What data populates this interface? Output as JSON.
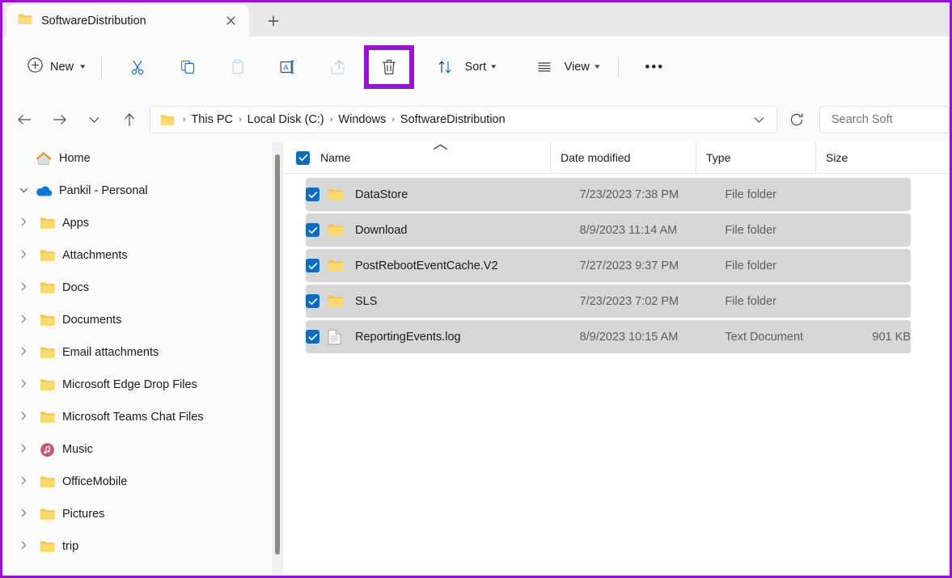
{
  "window": {
    "tab_title": "SoftwareDistribution",
    "tab_close_icon": "close-icon",
    "new_tab_icon": "plus-icon"
  },
  "toolbar": {
    "new_label": "New",
    "sort_label": "Sort",
    "view_label": "View",
    "overflow_label": "•••",
    "items": [
      {
        "name": "new-button",
        "icon": "plus-circle-icon",
        "enabled": true
      },
      {
        "name": "cut-button",
        "icon": "scissors-icon",
        "enabled": true
      },
      {
        "name": "copy-button",
        "icon": "copy-icon",
        "enabled": true
      },
      {
        "name": "paste-button",
        "icon": "clipboard-icon",
        "enabled": false
      },
      {
        "name": "rename-button",
        "icon": "rename-icon",
        "enabled": true
      },
      {
        "name": "share-button",
        "icon": "share-icon",
        "enabled": false
      },
      {
        "name": "delete-button",
        "icon": "trash-icon",
        "enabled": true,
        "highlighted": true
      },
      {
        "name": "sort-button",
        "icon": "sort-arrows-icon",
        "enabled": true
      },
      {
        "name": "view-button",
        "icon": "list-lines-icon",
        "enabled": true
      },
      {
        "name": "see-more-button",
        "icon": "ellipsis-icon",
        "enabled": true
      }
    ],
    "highlight_color": "#9614d0"
  },
  "address": {
    "back_icon": "arrow-left-icon",
    "forward_icon": "arrow-right-icon",
    "recent_icon": "chevron-down-icon",
    "up_icon": "arrow-up-icon",
    "folder_icon": "folder-icon",
    "breadcrumbs": [
      "This PC",
      "Local Disk (C:)",
      "Windows",
      "SoftwareDistribution"
    ],
    "separator": "›",
    "dropdown_icon": "chevron-down-icon",
    "refresh_icon": "refresh-icon",
    "search_value": "",
    "search_placeholder": "Search Soft"
  },
  "sidebar": {
    "items": [
      {
        "label": "Home",
        "icon": "home-icon",
        "expander": "",
        "indent": false
      },
      {
        "label": "Pankil - Personal",
        "icon": "onedrive-cloud-icon",
        "expander": "⌄",
        "indent": false,
        "expanded": true
      },
      {
        "label": "Apps",
        "icon": "folder-icon",
        "expander": "›",
        "indent": true
      },
      {
        "label": "Attachments",
        "icon": "folder-icon",
        "expander": "›",
        "indent": true
      },
      {
        "label": "Docs",
        "icon": "folder-icon",
        "expander": "›",
        "indent": true
      },
      {
        "label": "Documents",
        "icon": "folder-icon",
        "expander": "›",
        "indent": true
      },
      {
        "label": "Email attachments",
        "icon": "folder-icon",
        "expander": "›",
        "indent": true
      },
      {
        "label": "Microsoft Edge Drop Files",
        "icon": "folder-icon",
        "expander": "›",
        "indent": true
      },
      {
        "label": "Microsoft Teams Chat Files",
        "icon": "folder-icon",
        "expander": "›",
        "indent": true
      },
      {
        "label": "Music",
        "icon": "music-note-icon",
        "expander": "›",
        "indent": true
      },
      {
        "label": "OfficeMobile",
        "icon": "folder-icon",
        "expander": "›",
        "indent": true
      },
      {
        "label": "Pictures",
        "icon": "folder-icon",
        "expander": "›",
        "indent": true
      },
      {
        "label": "trip",
        "icon": "folder-icon",
        "expander": "›",
        "indent": true
      }
    ]
  },
  "file_list": {
    "select_all_checked": true,
    "sort_column": "Name",
    "sort_direction": "ascending",
    "columns": [
      {
        "label": "Name"
      },
      {
        "label": "Date modified"
      },
      {
        "label": "Type"
      },
      {
        "label": "Size"
      }
    ],
    "rows": [
      {
        "name": "DataStore",
        "date": "7/23/2023 7:38 PM",
        "type": "File folder",
        "size": "",
        "icon": "folder-icon",
        "selected": true,
        "checked": true
      },
      {
        "name": "Download",
        "date": "8/9/2023 11:14 AM",
        "type": "File folder",
        "size": "",
        "icon": "folder-icon",
        "selected": true,
        "checked": true
      },
      {
        "name": "PostRebootEventCache.V2",
        "date": "7/27/2023 9:37 PM",
        "type": "File folder",
        "size": "",
        "icon": "folder-icon",
        "selected": true,
        "checked": true
      },
      {
        "name": "SLS",
        "date": "7/23/2023 7:02 PM",
        "type": "File folder",
        "size": "",
        "icon": "folder-icon",
        "selected": true,
        "checked": true
      },
      {
        "name": "ReportingEvents.log",
        "date": "8/9/2023 10:15 AM",
        "type": "Text Document",
        "size": "901 KB",
        "icon": "text-document-icon",
        "selected": true,
        "checked": true
      }
    ]
  },
  "colors": {
    "accent": "#0f6cbd",
    "folder": "#ffc75b",
    "highlight": "#9614d0",
    "selection_row": "#d7d7d7"
  }
}
